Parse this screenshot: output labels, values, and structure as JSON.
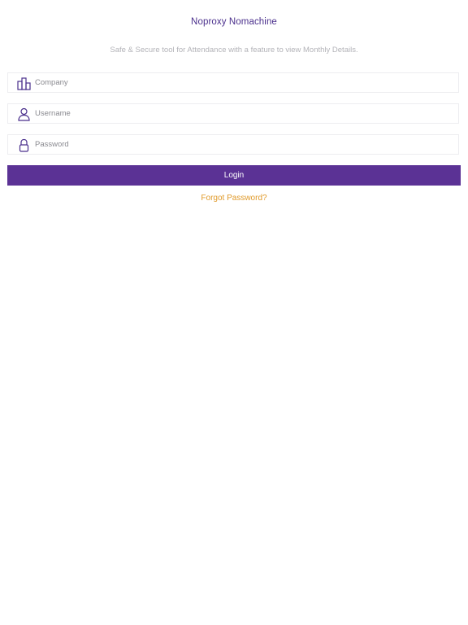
{
  "header": {
    "app_title": "Noproxy Nomachine",
    "subtitle": "Safe & Secure tool for Attendance with a feature to view Monthly Details."
  },
  "form": {
    "company": {
      "placeholder": "Company",
      "value": "",
      "icon": "building-icon"
    },
    "username": {
      "placeholder": "Username",
      "value": "",
      "icon": "user-icon"
    },
    "password": {
      "placeholder": "Password",
      "value": "",
      "icon": "lock-icon"
    },
    "login_label": "Login",
    "forgot_label": "Forgot Password?"
  },
  "colors": {
    "accent": "#5b3295",
    "title": "#4a2f8c",
    "icon": "#4a2f8c",
    "link": "#e09a2a",
    "muted_text": "#b3b3b8"
  }
}
